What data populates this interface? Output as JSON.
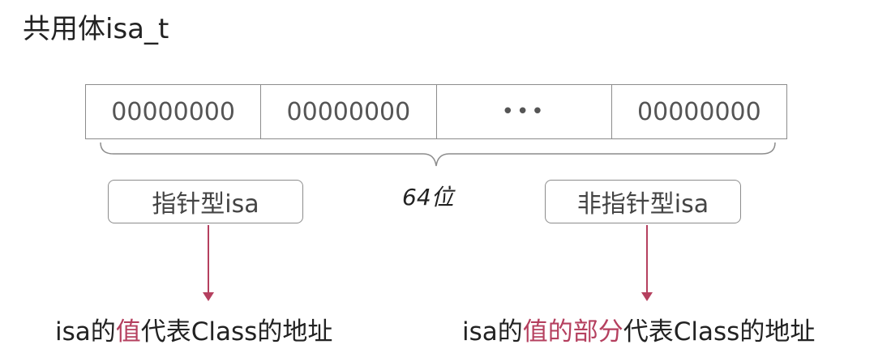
{
  "title": "共用体isa_t",
  "bit_cells": [
    "00000000",
    "00000000",
    "•••",
    "00000000"
  ],
  "total_bits_label": "64位",
  "pointer_type": {
    "label": "指针型isa",
    "desc_prefix": "isa的",
    "desc_highlight": "值",
    "desc_suffix": "代表Class的地址"
  },
  "non_pointer_type": {
    "label": "非指针型isa",
    "desc_prefix": "isa的",
    "desc_highlight": "值的部分",
    "desc_suffix": "代表Class的地址"
  },
  "colors": {
    "highlight": "#b5405f",
    "arrow": "#b5405f",
    "border": "#8c8c8c"
  }
}
